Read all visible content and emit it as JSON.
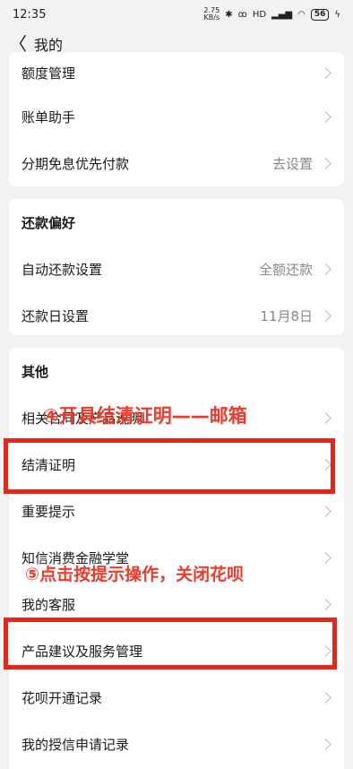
{
  "status_bar": {
    "time": "12:35",
    "net_speed_top": "2.75",
    "net_speed_bottom": "KB/s",
    "icons": [
      "bluetooth-icon",
      "headphones-icon",
      "signal-icon",
      "wifi-icon"
    ],
    "hd_label": "HD",
    "battery": "56"
  },
  "nav": {
    "back_icon": "chevron-left-icon",
    "title": "我的"
  },
  "card1": {
    "rows": [
      {
        "label": "额度管理",
        "value": ""
      },
      {
        "label": "账单助手",
        "value": ""
      },
      {
        "label": "分期免息优先付款",
        "value": "去设置"
      }
    ]
  },
  "card2": {
    "title": "还款偏好",
    "rows": [
      {
        "label": "自动还款设置",
        "value": "全额还款"
      },
      {
        "label": "还款日设置",
        "value": "11月8日"
      }
    ]
  },
  "card3": {
    "title": "其他",
    "rows": [
      {
        "label": "相关合同及产品说明",
        "value": ""
      },
      {
        "label": "结清证明",
        "value": ""
      },
      {
        "label": "重要提示",
        "value": ""
      },
      {
        "label": "知信消费金融学堂",
        "value": ""
      },
      {
        "label": "我的客服",
        "value": ""
      },
      {
        "label": "产品建议及服务管理",
        "value": ""
      },
      {
        "label": "花呗开通记录",
        "value": ""
      },
      {
        "label": "我的授信申请记录",
        "value": ""
      }
    ]
  },
  "annotations": {
    "step4": "④开具结清证明——邮箱",
    "step5": "⑤点击按提示操作，关闭花呗",
    "color": "#ee3a2a"
  }
}
